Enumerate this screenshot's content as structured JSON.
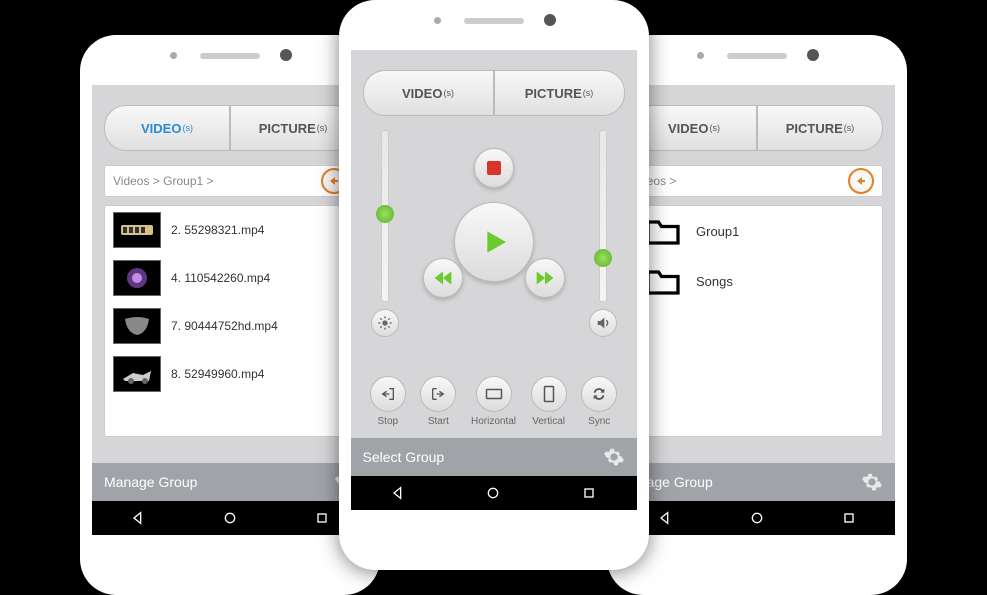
{
  "tabs": {
    "video": "VIDEO",
    "video_suffix": "(s)",
    "picture": "PICTURE",
    "picture_suffix": "(s)"
  },
  "left": {
    "breadcrumb": "Videos > Group1 >",
    "files": [
      {
        "name": "2. 55298321.mp4"
      },
      {
        "name": "4. 110542260.mp4"
      },
      {
        "name": "7. 90444752hd.mp4"
      },
      {
        "name": "8. 52949960.mp4"
      }
    ],
    "footer": "Manage Group"
  },
  "center": {
    "actions": {
      "stop": "Stop",
      "start": "Start",
      "horizontal": "Horizontal",
      "vertical": "Vertical",
      "sync": "Sync"
    },
    "footer": "Select Group"
  },
  "right": {
    "breadcrumb": "deos >",
    "folders": [
      {
        "name": "Group1"
      },
      {
        "name": "Songs"
      }
    ],
    "footer": "anage Group"
  }
}
